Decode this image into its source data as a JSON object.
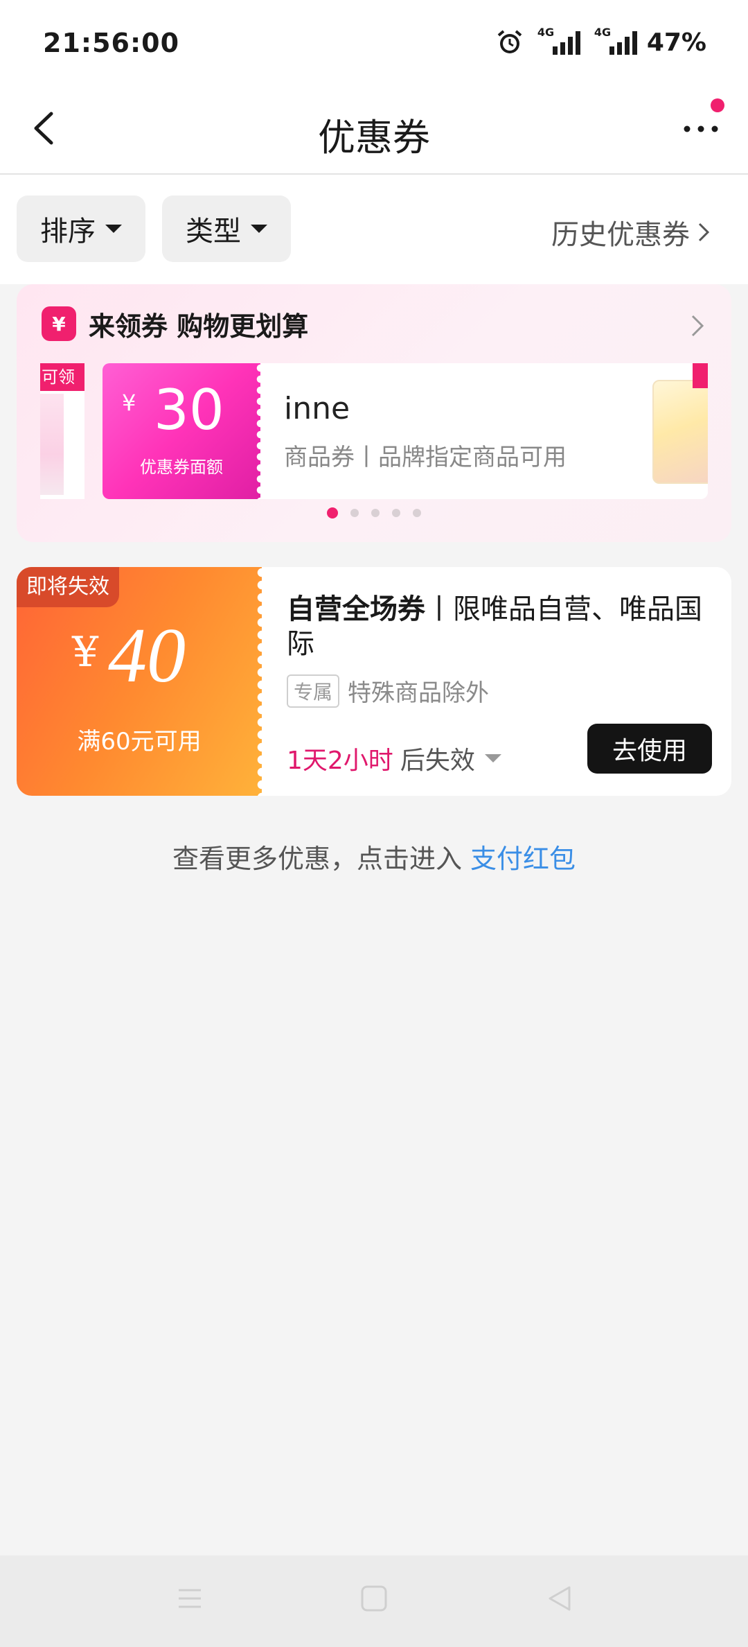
{
  "status_bar": {
    "time": "21:56:00",
    "network1": "4G",
    "network2": "4G",
    "battery": "47%"
  },
  "nav": {
    "title": "优惠券"
  },
  "filters": {
    "sort_label": "排序",
    "type_label": "类型",
    "history_label": "历史优惠券"
  },
  "promo": {
    "badge": "¥",
    "title": "来领券 购物更划算",
    "left_peek_ribbon": "可领",
    "slide": {
      "currency": "¥",
      "amount": "30",
      "amount_caption": "优惠券面额",
      "name": "inne",
      "description": "商品券丨品牌指定商品可用"
    },
    "active_index": 1,
    "total_slides": 5
  },
  "coupon": {
    "badge": "即将失效",
    "currency": "¥",
    "amount": "40",
    "threshold": "满60元可用",
    "name_bold": "自营全场券",
    "name_rest": "丨限唯品自营、唯品国际",
    "scope_tag": "专属",
    "scope_text": "特殊商品除外",
    "expire_time": "1天2小时",
    "expire_suffix": "后失效",
    "use_button": "去使用"
  },
  "more_hint": {
    "text": "查看更多优惠，点击进入 ",
    "link": "支付红包"
  },
  "colors": {
    "brand_pink": "#f0206e",
    "coupon_orange": "#ff8a30",
    "link_blue": "#3a8ee6"
  }
}
